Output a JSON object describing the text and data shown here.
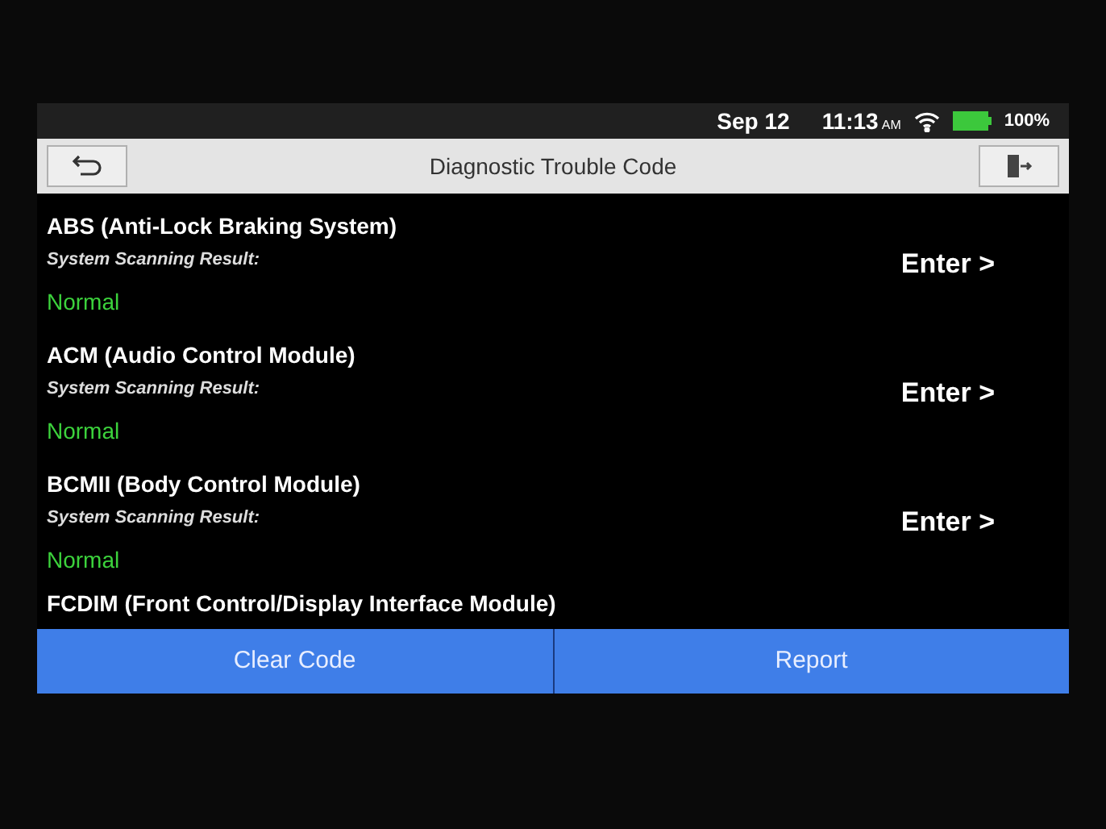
{
  "status_bar": {
    "date": "Sep 12",
    "time": "11:13",
    "meridiem": "AM",
    "battery": "100%"
  },
  "header": {
    "title": "Diagnostic Trouble Code"
  },
  "systems": [
    {
      "name": "ABS (Anti-Lock Braking System)",
      "result_label": "System Scanning Result:",
      "result": "Normal",
      "action": "Enter >"
    },
    {
      "name": "ACM (Audio Control Module)",
      "result_label": "System Scanning Result:",
      "result": "Normal",
      "action": "Enter >"
    },
    {
      "name": "BCMII (Body Control Module)",
      "result_label": "System Scanning Result:",
      "result": "Normal",
      "action": "Enter >"
    },
    {
      "name": "FCDIM (Front Control/Display Interface Module)"
    }
  ],
  "buttons": [
    "Clear Code",
    "Report"
  ]
}
